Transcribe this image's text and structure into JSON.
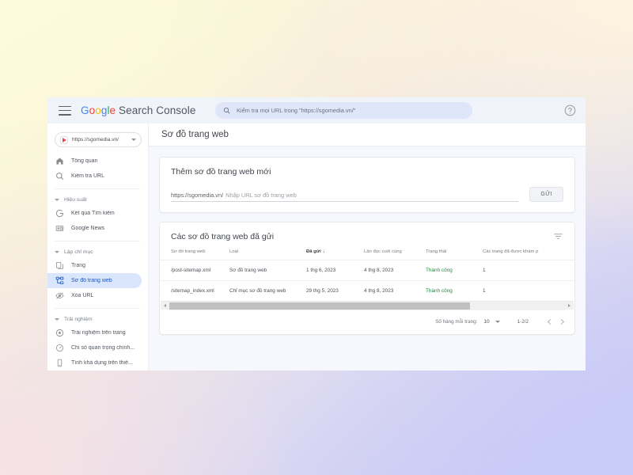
{
  "topbar": {
    "menu_icon": "hamburger-icon",
    "brand": {
      "google": "Google",
      "product": "Search Console"
    },
    "search": {
      "icon": "search-icon",
      "placeholder": "Kiểm tra mọi URL trong \"https://sgomedia.vn/\""
    },
    "help_icon": "help-circle-icon"
  },
  "sidebar": {
    "property": {
      "icon": "property-flag-icon",
      "label": "https://sgomedia.vn/",
      "caret": "chevron-down-icon"
    },
    "items": [
      {
        "label": "Tổng quan",
        "icon": "home-icon",
        "active": false
      },
      {
        "label": "Kiểm tra URL",
        "icon": "search-icon",
        "active": false
      }
    ],
    "groups": [
      {
        "label": "Hiệu suất",
        "items": [
          {
            "label": "Kết quả Tìm kiếm",
            "icon": "google-g-icon",
            "active": false
          },
          {
            "label": "Google News",
            "icon": "newspaper-icon",
            "active": false
          }
        ]
      },
      {
        "label": "Lập chỉ mục",
        "items": [
          {
            "label": "Trang",
            "icon": "pages-icon",
            "active": false
          },
          {
            "label": "Sơ đồ trang web",
            "icon": "sitemap-icon",
            "active": true
          },
          {
            "label": "Xóa URL",
            "icon": "eye-off-icon",
            "active": false
          }
        ]
      },
      {
        "label": "Trải nghiệm",
        "items": [
          {
            "label": "Trải nghiệm trên trang",
            "icon": "target-icon",
            "active": false
          },
          {
            "label": "Chỉ số quan trọng chính...",
            "icon": "speedometer-icon",
            "active": false
          },
          {
            "label": "Tính khả dụng trên thiế...",
            "icon": "mobile-device-icon",
            "active": false
          }
        ]
      }
    ]
  },
  "page": {
    "title": "Sơ đồ trang web"
  },
  "add_sitemap": {
    "title": "Thêm sơ đồ trang web mới",
    "url_prefix": "https://sgomedia.vn/",
    "input_value": "",
    "input_placeholder": "Nhập URL sơ đồ trang web",
    "submit_label": "GỬI"
  },
  "submitted": {
    "title": "Các sơ đồ trang web đã gửi",
    "filter_icon": "filter-icon",
    "columns": [
      {
        "label": "Sơ đồ trang web",
        "sorted": false
      },
      {
        "label": "Loại",
        "sorted": false
      },
      {
        "label": "Đã gửi",
        "sorted": true,
        "sort_arrow": "↓"
      },
      {
        "label": "Lần đọc cuối cùng",
        "sorted": false
      },
      {
        "label": "Trạng thái",
        "sorted": false
      },
      {
        "label": "Các trang đã được khám p",
        "sorted": false
      }
    ],
    "rows": [
      {
        "sitemap": "/post-sitemap.xml",
        "type": "Sơ đồ trang web",
        "submitted": "1 thg 6, 2023",
        "last_read": "4 thg 8, 2023",
        "status": "Thành công",
        "discovered": "1"
      },
      {
        "sitemap": "/sitemap_index.xml",
        "type": "Chỉ mục sơ đồ trang web",
        "submitted": "29 thg 5, 2023",
        "last_read": "4 thg 8, 2023",
        "status": "Thành công",
        "discovered": "1"
      }
    ],
    "footer": {
      "rows_per_page_label": "Số hàng mỗi trang:",
      "rows_per_page_value": "10",
      "range": "1-2/2",
      "prev_icon": "chevron-left-icon",
      "next_icon": "chevron-right-icon"
    },
    "scrollbar": {
      "left_icon": "scroll-left-arrow",
      "right_icon": "scroll-right-arrow"
    }
  },
  "colors": {
    "accent_blue": "#1a56c4",
    "active_bg": "#d9e6fb",
    "success_green": "#1e8e3e",
    "topbar_bg": "#f1f3fb",
    "search_bg": "#dfe6f9",
    "main_bg": "#f7f8fd"
  }
}
